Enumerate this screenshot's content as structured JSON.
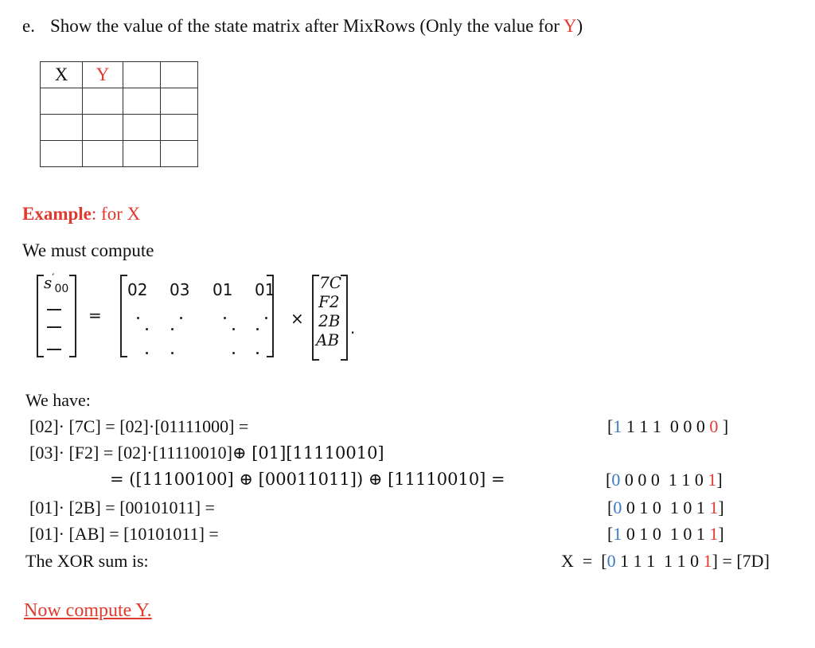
{
  "question": {
    "label": "e.",
    "text_before": "Show the value of the state matrix after MixRows (Only the value for ",
    "highlight": "Y",
    "text_after": ")"
  },
  "answer_table": {
    "header": [
      "X",
      "Y",
      "",
      ""
    ],
    "rows": [
      [
        "",
        "",
        "",
        ""
      ],
      [
        "",
        "",
        "",
        ""
      ],
      [
        "",
        "",
        "",
        ""
      ]
    ]
  },
  "example": {
    "title_bold": "Example",
    "title_rest": ": for X",
    "intro": "We must compute"
  },
  "equation": {
    "lhs_symbol": "s",
    "lhs_prime": "′",
    "lhs_subscript": "00",
    "equals": "=",
    "matrix_row": [
      "02",
      "03",
      "01",
      "01"
    ],
    "times": "×",
    "vector": [
      "7C",
      "F2",
      "2B",
      "AB"
    ],
    "period": "."
  },
  "work": {
    "heading": "We   have:",
    "lines": [
      {
        "text": "[02]· [7C] = [02]·[01111000] ="
      },
      {
        "text": "[03]· [F2] = [02]·[11110010]",
        "text_math": "⊕ [01][11110010]"
      },
      {
        "text_math": "= ([11100100] ⊕ [00011011]) ⊕ [11110010] ="
      },
      {
        "text": "[01]· [2B] =  [00101011] ="
      },
      {
        "text": "[01]· [AB] = [10101011]  ="
      },
      {
        "text": "The XOR sum is:"
      }
    ],
    "results": [
      {
        "open": "[",
        "first": "1",
        "middle": " 1 1 1  0 0 0 ",
        "last": "0",
        "close": " ]"
      },
      {
        "open": "[",
        "first": "0",
        "middle": " 0 0 0  1 1 0 ",
        "last": "1",
        "close": "]"
      },
      {
        "open": "[",
        "first": "0",
        "middle": " 0 1 0  1 0 1 ",
        "last": "1",
        "close": "]"
      },
      {
        "open": "[",
        "first": "1",
        "middle": " 0 1 0  1 0 1 ",
        "last": "1",
        "close": "]"
      }
    ],
    "sum": {
      "prefix": "X  =  [",
      "first": "0",
      "middle": " 1 1 1  1 1 0 ",
      "last": "1",
      "close": "] = [7D]"
    }
  },
  "cta": "Now compute Y.",
  "colors": {
    "accent_red": "#e03a2e",
    "accent_blue": "#3a78c2",
    "text": "#111111"
  }
}
